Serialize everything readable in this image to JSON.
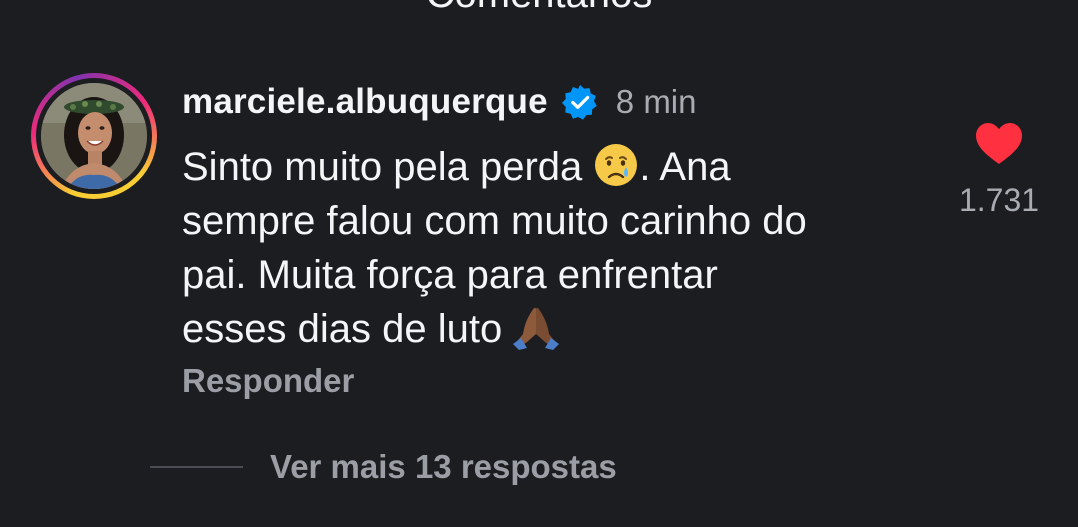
{
  "header": {
    "title": "Comentários"
  },
  "comment": {
    "username": "marciele.albuquerque",
    "verified": true,
    "timestamp": "8 min",
    "text_lines": [
      "Sinto muito pela perda",
      ". Ana",
      "sempre falou com muito carinho do",
      "pai. Muita força para enfrentar",
      "esses dias de luto"
    ],
    "emojis": [
      "crying-face",
      "folded-hands"
    ],
    "reply_label": "Responder",
    "likes": "1.731",
    "liked": true
  },
  "replies": {
    "more_label": "Ver mais 13 respostas"
  },
  "colors": {
    "background": "#1b1d21",
    "text": "#f4f5f7",
    "muted": "#9b9ea5",
    "like": "#ff3040",
    "verified": "#0095f6"
  }
}
